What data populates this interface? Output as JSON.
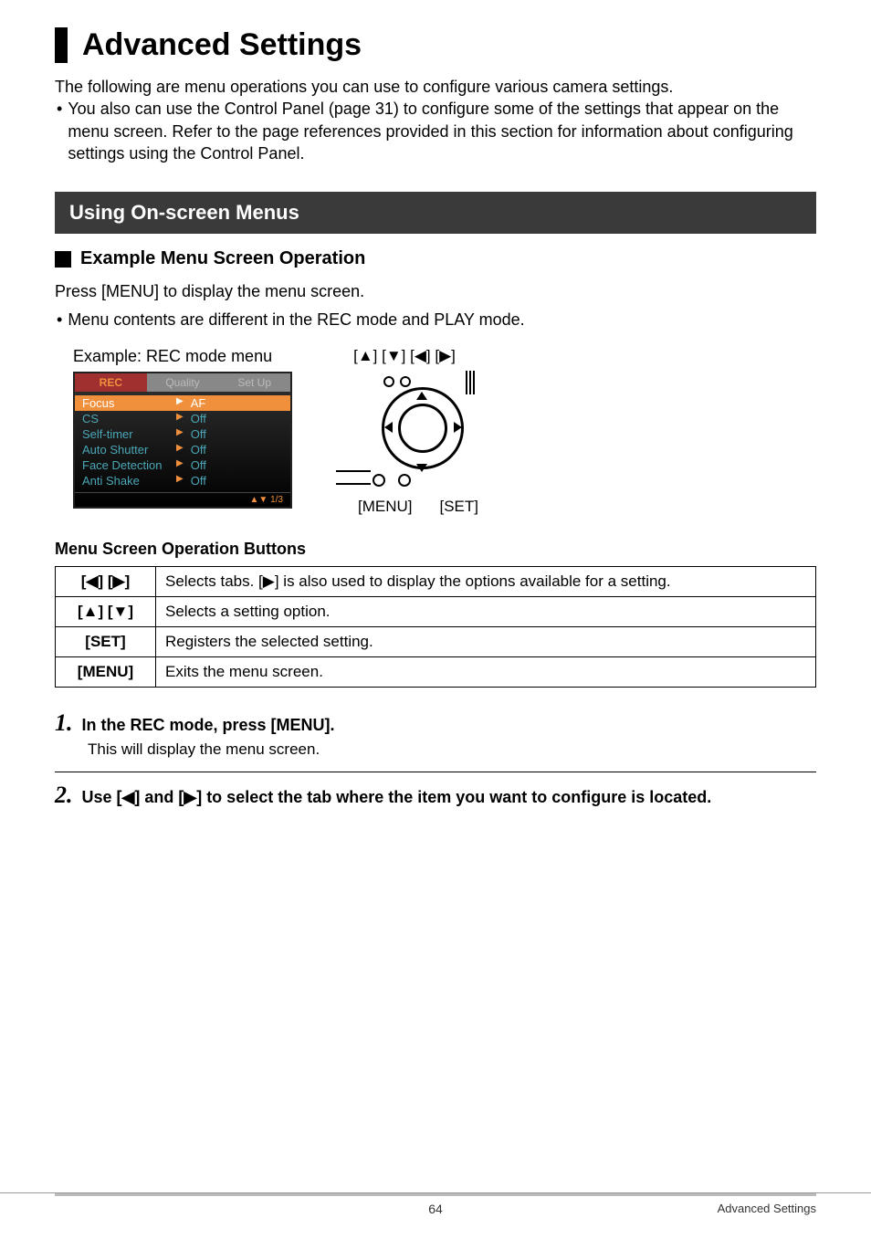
{
  "page_title": "Advanced Settings",
  "intro_line": "The following are menu operations you can use to configure various camera settings.",
  "intro_bullet": "You also can use the Control Panel (page 31) to configure some of the settings that appear on the menu screen. Refer to the page references provided in this section for information about configuring settings using the Control Panel.",
  "section_bar": "Using On-screen Menus",
  "subhead": "Example Menu Screen Operation",
  "press_line": "Press [MENU] to display the menu screen.",
  "press_bullet": "Menu contents are different in the REC mode and PLAY mode.",
  "example_caption": "Example: REC mode menu",
  "dpad_label": "[▲] [▼] [◀] [▶]",
  "diagram_menu": "[MENU]",
  "diagram_set": "[SET]",
  "menu_mock": {
    "tabs": [
      "REC",
      "Quality",
      "Set Up"
    ],
    "items": [
      {
        "label": "Focus",
        "value": "AF",
        "selected": true
      },
      {
        "label": "CS",
        "value": "Off",
        "selected": false
      },
      {
        "label": "Self-timer",
        "value": "Off",
        "selected": false
      },
      {
        "label": "Auto Shutter",
        "value": "Off",
        "selected": false
      },
      {
        "label": "Face Detection",
        "value": "Off",
        "selected": false
      },
      {
        "label": "Anti Shake",
        "value": "Off",
        "selected": false
      }
    ],
    "footer": "1/3"
  },
  "table_heading": "Menu Screen Operation Buttons",
  "table_rows": [
    {
      "key": "[◀] [▶]",
      "desc": "Selects tabs. [▶] is also used to display the options available for a setting."
    },
    {
      "key": "[▲] [▼]",
      "desc": "Selects a setting option."
    },
    {
      "key": "[SET]",
      "desc": "Registers the selected setting."
    },
    {
      "key": "[MENU]",
      "desc": "Exits the menu screen."
    }
  ],
  "steps": [
    {
      "num": "1.",
      "title": "In the REC mode, press [MENU].",
      "sub": "This will display the menu screen."
    },
    {
      "num": "2.",
      "title": "Use [◀] and [▶] to select the tab where the item you want to configure is located.",
      "sub": ""
    }
  ],
  "footer_page": "64",
  "footer_right": "Advanced Settings"
}
